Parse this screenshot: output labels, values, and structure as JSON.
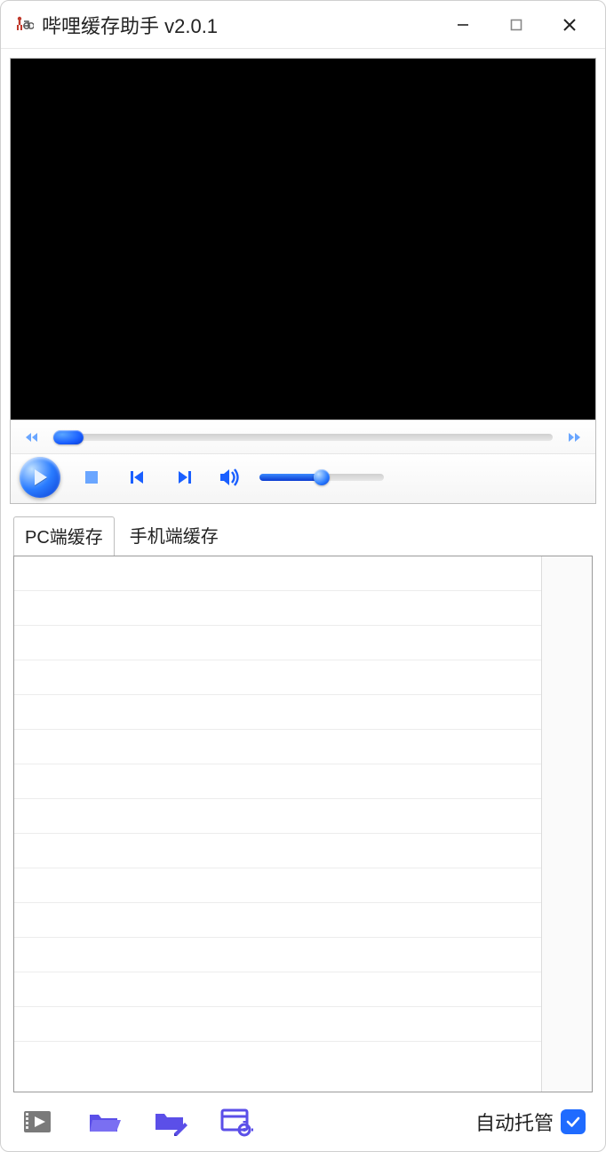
{
  "titlebar": {
    "title": "哔哩缓存助手 v2.0.1"
  },
  "player": {
    "seek_position_pct": 0,
    "volume_pct": 50
  },
  "tabs": {
    "items": [
      {
        "label": "PC端缓存",
        "active": true
      },
      {
        "label": "手机端缓存",
        "active": false
      }
    ]
  },
  "list": {
    "rows": []
  },
  "toolbar": {
    "auto_manage_label": "自动托管",
    "auto_manage_checked": true
  },
  "icons": {
    "video_file": "video-file-icon",
    "folder_open": "folder-open-icon",
    "folder_edit": "folder-edit-icon",
    "window_settings": "window-settings-icon"
  },
  "colors": {
    "accent": "#5b4fe8",
    "toggle": "#1f6bff",
    "player_blue": "#1a5fff"
  }
}
